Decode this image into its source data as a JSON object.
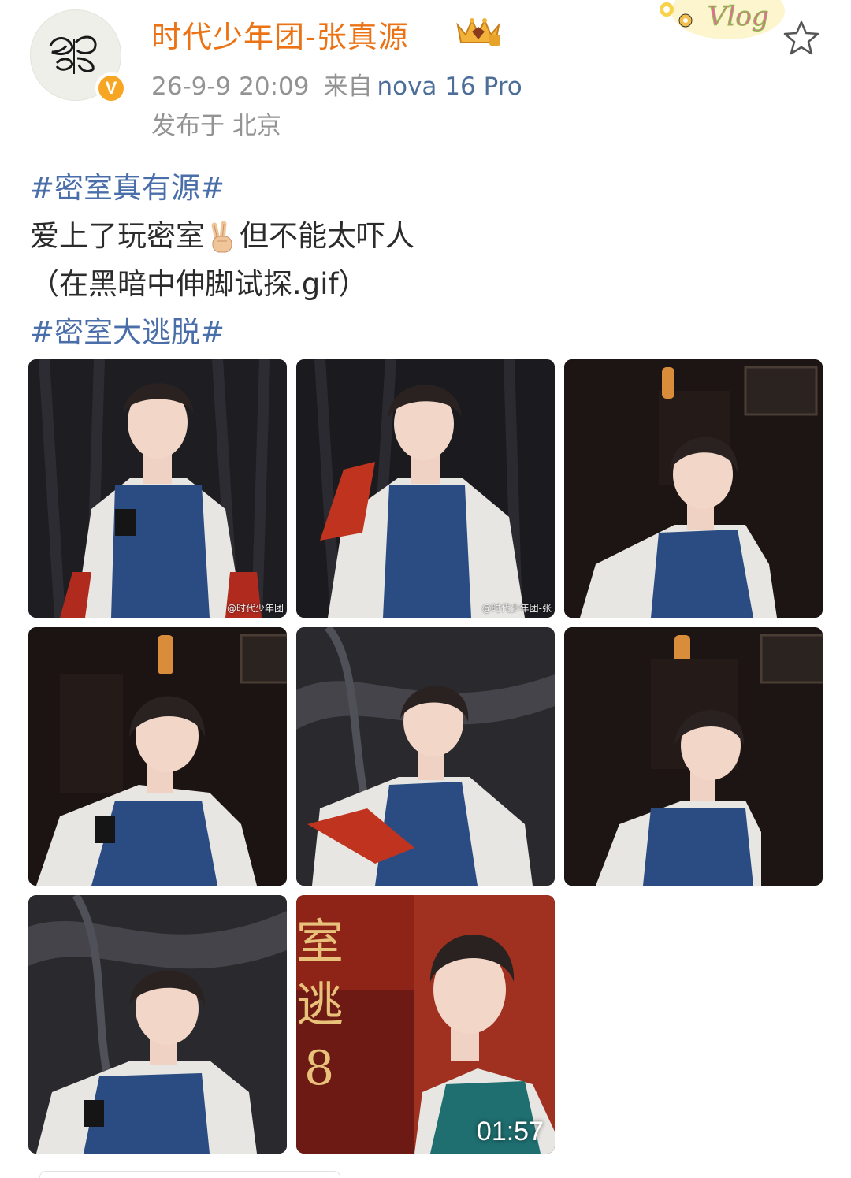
{
  "post": {
    "username": "时代少年团-张真源",
    "timestamp": "26-9-9 20:09",
    "from_label": "来自",
    "device": "nova 16 Pro",
    "location": "发布于 北京",
    "verified_badge": "V",
    "decor_text": "Vlog"
  },
  "content": {
    "topic1": "#密室真有源#",
    "text_part1": "爱上了玩密室",
    "emoji": "victory-hand",
    "text_part2": "但不能太吓人",
    "line3": "（在黑暗中伸脚试探.gif）",
    "topic2": "#密室大逃脱#"
  },
  "photos": [
    {
      "watermark": "@时代少年团",
      "scene": "dark-curtain"
    },
    {
      "watermark": "@时代少年团-张",
      "scene": "dark-curtain"
    },
    {
      "watermark": "",
      "scene": "room-lantern"
    },
    {
      "watermark": "",
      "scene": "room-lantern"
    },
    {
      "watermark": "",
      "scene": "leather-wall"
    },
    {
      "watermark": "",
      "scene": "room-lantern"
    },
    {
      "watermark": "",
      "scene": "leather-wall"
    },
    {
      "watermark": "",
      "scene": "video-cover",
      "duration": "01:57"
    }
  ],
  "icons": [
    "verified-v-icon",
    "crown-badge-icon",
    "star-icon",
    "victory-hand-emoji",
    "play-duration"
  ],
  "colors": {
    "username": "#eb7315",
    "topic": "#4a6ea9",
    "meta": "#939393",
    "device": "#4e6e9a",
    "badge": "#f6a623"
  }
}
